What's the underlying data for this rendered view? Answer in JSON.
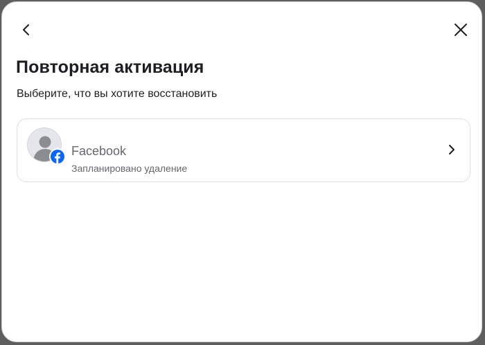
{
  "dialog": {
    "title": "Повторная активация",
    "subtitle": "Выберите, что вы хотите восстановить",
    "back_icon": "chevron-left-icon",
    "close_icon": "close-icon"
  },
  "account": {
    "name": "Facebook",
    "status": "Запланировано удаление",
    "avatar_icon": "default-profile-avatar",
    "badge_icon": "facebook-logo-icon",
    "chevron_icon": "chevron-right-icon"
  },
  "colors": {
    "text_primary": "#1c1e21",
    "text_secondary": "#65676b",
    "facebook_blue": "#0866ff",
    "card_border": "#dcdfe3"
  }
}
